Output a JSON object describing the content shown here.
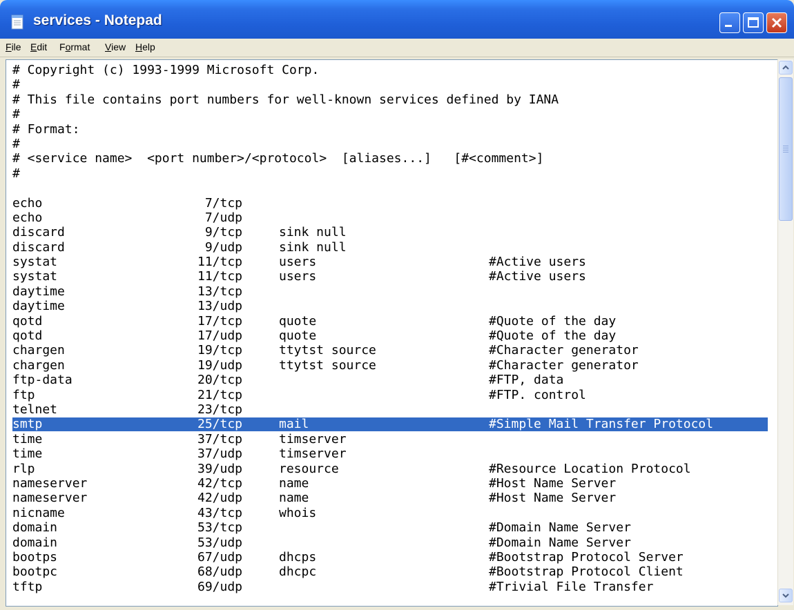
{
  "window": {
    "title": "services - Notepad",
    "icon": "notepad-icon"
  },
  "menu": [
    {
      "label": "File",
      "underline": "F",
      "rest": "ile"
    },
    {
      "label": "Edit",
      "underline": "E",
      "rest": "dit"
    },
    {
      "label": "Format",
      "underline": "o",
      "pre": "F",
      "rest": "rmat"
    },
    {
      "label": "View",
      "underline": "V",
      "rest": "iew"
    },
    {
      "label": "Help",
      "underline": "H",
      "rest": "elp"
    }
  ],
  "header_lines": [
    "# Copyright (c) 1993-1999 Microsoft Corp.",
    "#",
    "# This file contains port numbers for well-known services defined by IANA",
    "#",
    "# Format:",
    "#",
    "# <service name>  <port number>/<protocol>  [aliases...]   [#<comment>]",
    "#",
    ""
  ],
  "services": [
    {
      "name": "echo",
      "port": "7/tcp",
      "aliases": "",
      "comment": ""
    },
    {
      "name": "echo",
      "port": "7/udp",
      "aliases": "",
      "comment": ""
    },
    {
      "name": "discard",
      "port": "9/tcp",
      "aliases": "sink null",
      "comment": ""
    },
    {
      "name": "discard",
      "port": "9/udp",
      "aliases": "sink null",
      "comment": ""
    },
    {
      "name": "systat",
      "port": "11/tcp",
      "aliases": "users",
      "comment": "#Active users"
    },
    {
      "name": "systat",
      "port": "11/tcp",
      "aliases": "users",
      "comment": "#Active users"
    },
    {
      "name": "daytime",
      "port": "13/tcp",
      "aliases": "",
      "comment": ""
    },
    {
      "name": "daytime",
      "port": "13/udp",
      "aliases": "",
      "comment": ""
    },
    {
      "name": "qotd",
      "port": "17/tcp",
      "aliases": "quote",
      "comment": "#Quote of the day"
    },
    {
      "name": "qotd",
      "port": "17/udp",
      "aliases": "quote",
      "comment": "#Quote of the day"
    },
    {
      "name": "chargen",
      "port": "19/tcp",
      "aliases": "ttytst source",
      "comment": "#Character generator"
    },
    {
      "name": "chargen",
      "port": "19/udp",
      "aliases": "ttytst source",
      "comment": "#Character generator"
    },
    {
      "name": "ftp-data",
      "port": "20/tcp",
      "aliases": "",
      "comment": "#FTP, data"
    },
    {
      "name": "ftp",
      "port": "21/tcp",
      "aliases": "",
      "comment": "#FTP. control"
    },
    {
      "name": "telnet",
      "port": "23/tcp",
      "aliases": "",
      "comment": ""
    },
    {
      "name": "smtp",
      "port": "25/tcp",
      "aliases": "mail",
      "comment": "#Simple Mail Transfer Protocol",
      "selected": true
    },
    {
      "name": "time",
      "port": "37/tcp",
      "aliases": "timserver",
      "comment": ""
    },
    {
      "name": "time",
      "port": "37/udp",
      "aliases": "timserver",
      "comment": ""
    },
    {
      "name": "rlp",
      "port": "39/udp",
      "aliases": "resource",
      "comment": "#Resource Location Protocol"
    },
    {
      "name": "nameserver",
      "port": "42/tcp",
      "aliases": "name",
      "comment": "#Host Name Server"
    },
    {
      "name": "nameserver",
      "port": "42/udp",
      "aliases": "name",
      "comment": "#Host Name Server"
    },
    {
      "name": "nicname",
      "port": "43/tcp",
      "aliases": "whois",
      "comment": ""
    },
    {
      "name": "domain",
      "port": "53/tcp",
      "aliases": "",
      "comment": "#Domain Name Server"
    },
    {
      "name": "domain",
      "port": "53/udp",
      "aliases": "",
      "comment": "#Domain Name Server"
    },
    {
      "name": "bootps",
      "port": "67/udp",
      "aliases": "dhcps",
      "comment": "#Bootstrap Protocol Server"
    },
    {
      "name": "bootpc",
      "port": "68/udp",
      "aliases": "dhcpc",
      "comment": "#Bootstrap Protocol Client"
    },
    {
      "name": "tftp",
      "port": "69/udp",
      "aliases": "",
      "comment": "#Trivial File Transfer"
    }
  ],
  "colors": {
    "titlebar": "#2a6fe6",
    "selection": "#316ac5",
    "close_button": "#c2381c"
  }
}
